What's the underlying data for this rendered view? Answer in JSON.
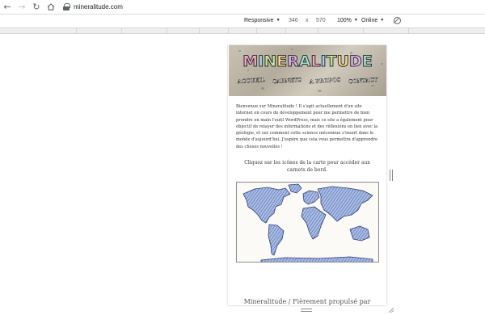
{
  "browser": {
    "back_icon": "arrow-left-icon",
    "forward_icon": "arrow-right-icon",
    "reload_icon": "reload-icon",
    "home_icon": "home-icon",
    "url": "mineralitude.com"
  },
  "device_toolbar": {
    "mode": "Responsive",
    "width": "346",
    "times": "x",
    "height": "570",
    "zoom": "100%",
    "throttle": "Online",
    "rotate_icon": "rotate-icon"
  },
  "site": {
    "logo": "MINERALITUDE",
    "nav": [
      "ACCUEIL",
      "CARNETS",
      "A PROPOS",
      "CONTACT"
    ],
    "intro": "Bienvenue sur Mineralitude ! Il s'agit actuellement d'un site internet en cours de développement pour me permettre de bien prendre en main l'outil WordPress, mais ce site a également pour objectif de relayer des informations et des réflexions en lien avec la géologie, et sur comment cette science méconnue s'insert dans le monde d'aujourd'hui. J'espère que cela vous permettra d'apprendre des choses nouvelles !",
    "map_caption": "Cliquez sur les icônes de la carte pour accéder aux carnets de bord.",
    "footer": "Mineralitude  /  Fièrement propulsé par"
  },
  "colors": {
    "map_fill": "#a9bde6",
    "map_stroke": "#2d3e7a"
  }
}
